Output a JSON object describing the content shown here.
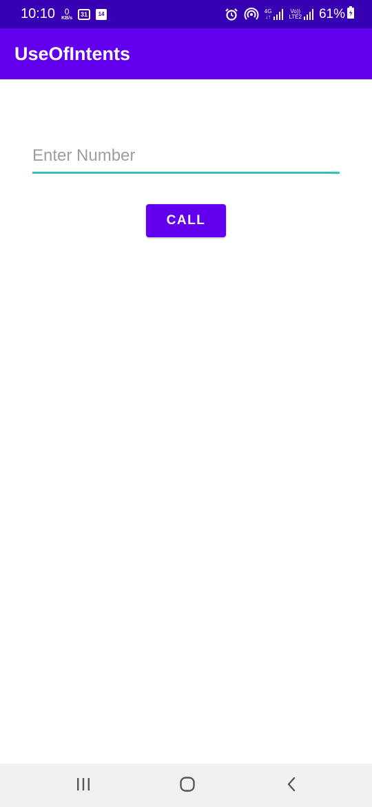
{
  "status_bar": {
    "time": "10:10",
    "net_speed_value": "0",
    "net_speed_unit": "KB/s",
    "calendar_badge": "31",
    "notification_badge": "14",
    "network_type": "4G",
    "volte_label_top": "Vo))",
    "volte_label_bottom": "LTE2",
    "battery_percent": "61%",
    "icons": [
      "alarm-icon",
      "hotspot-icon",
      "signal-icon",
      "signal-icon",
      "battery-icon"
    ]
  },
  "app_bar": {
    "title": "UseOfIntents",
    "color": "#6200ee"
  },
  "form": {
    "number_placeholder": "Enter Number",
    "number_value": "",
    "underline_color": "#2ec4b6",
    "call_label": "CALL"
  },
  "nav_bar": {
    "buttons": [
      "recents-icon",
      "home-icon",
      "back-icon"
    ]
  }
}
